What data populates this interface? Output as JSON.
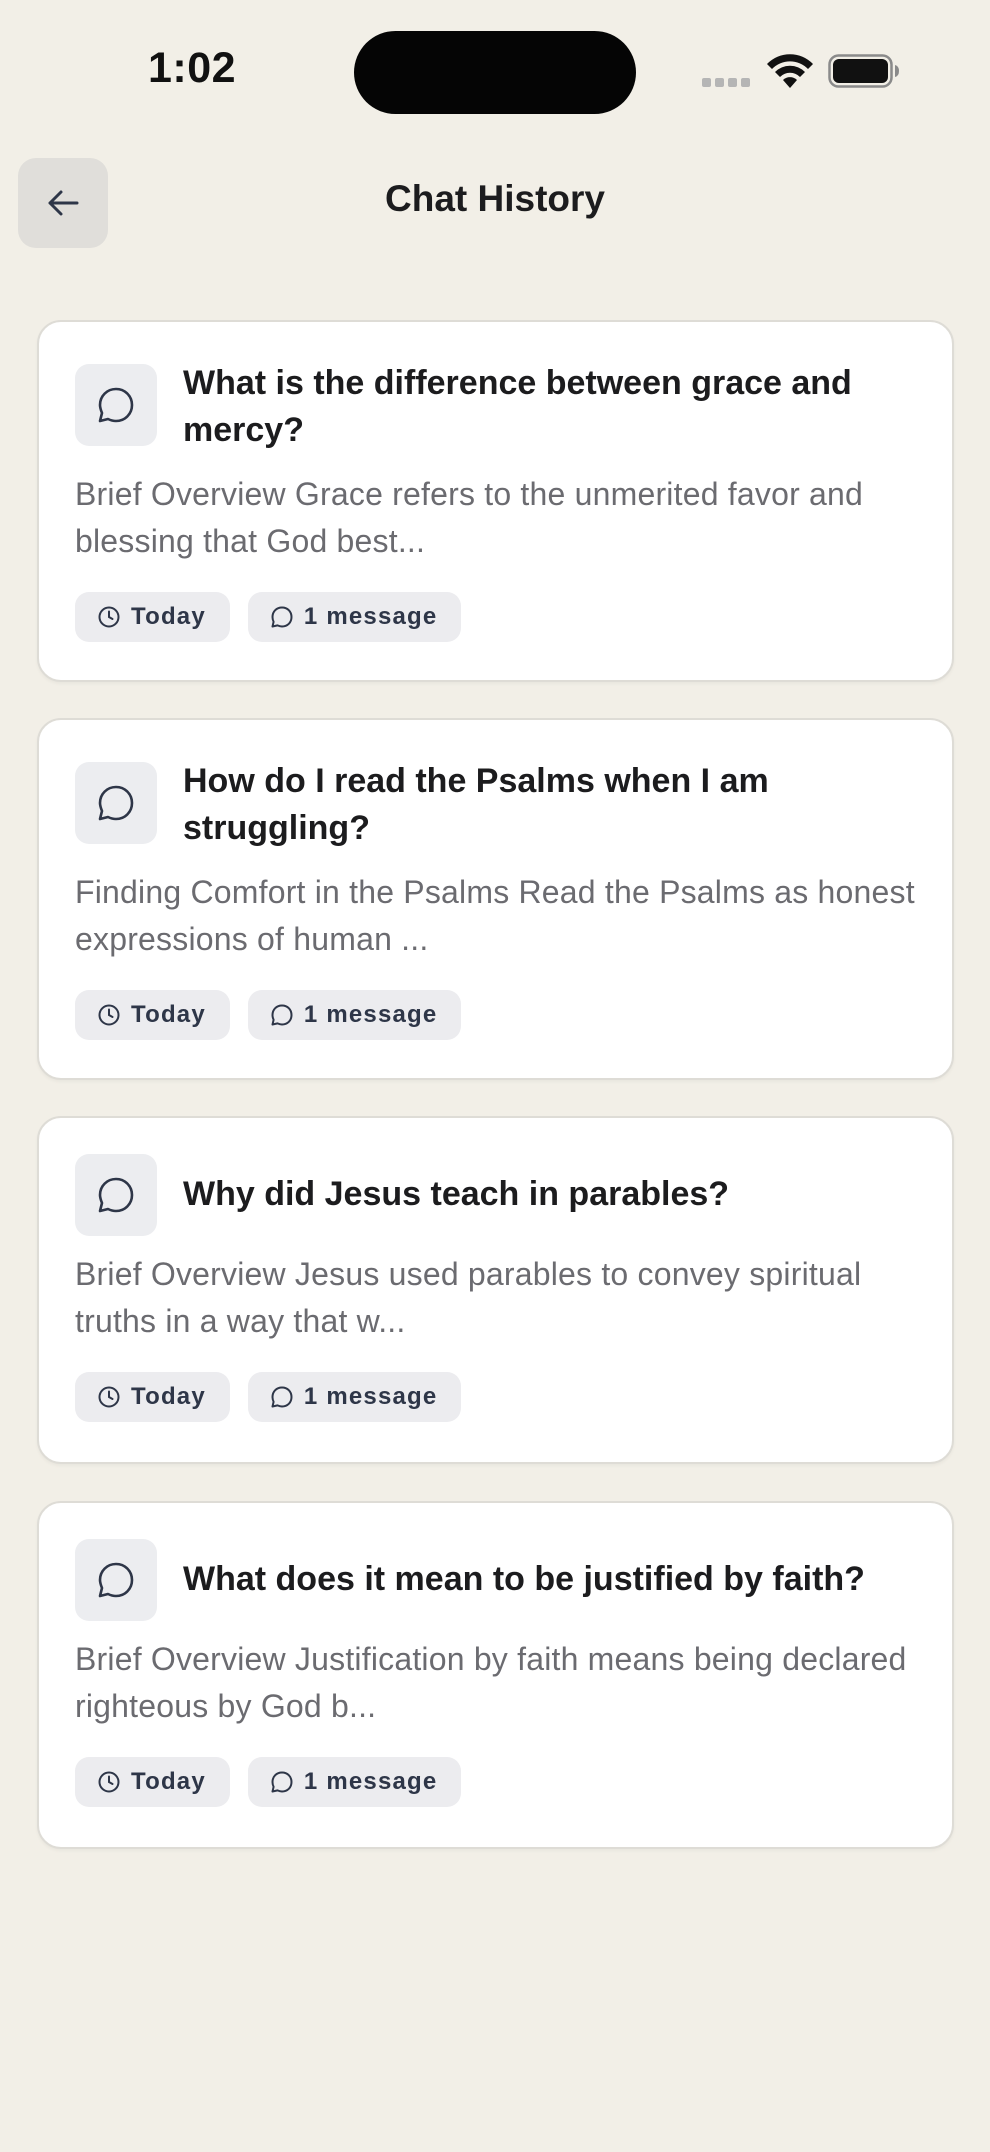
{
  "status_bar": {
    "time": "1:02"
  },
  "header": {
    "title": "Chat History"
  },
  "icons": {
    "back": "arrow-left-icon",
    "chat": "chat-bubble-icon",
    "clock": "clock-icon"
  },
  "chats": [
    {
      "title": "What is the difference between grace and mercy?",
      "preview": "Brief Overview Grace refers to the unmerited favor and blessing that God best...",
      "date": "Today",
      "messages": "1 message"
    },
    {
      "title": "How do I read the Psalms when I am struggling?",
      "preview": "Finding Comfort in the Psalms Read the Psalms as honest expressions of human ...",
      "date": "Today",
      "messages": "1 message"
    },
    {
      "title": "Why did Jesus teach in parables?",
      "preview": "Brief Overview Jesus used parables to convey spiritual truths in a way that w...",
      "date": "Today",
      "messages": "1 message"
    },
    {
      "title": "What does it mean to be justified by faith?",
      "preview": "Brief Overview Justification by faith means being declared righteous by God b...",
      "date": "Today",
      "messages": "1 message"
    }
  ]
}
